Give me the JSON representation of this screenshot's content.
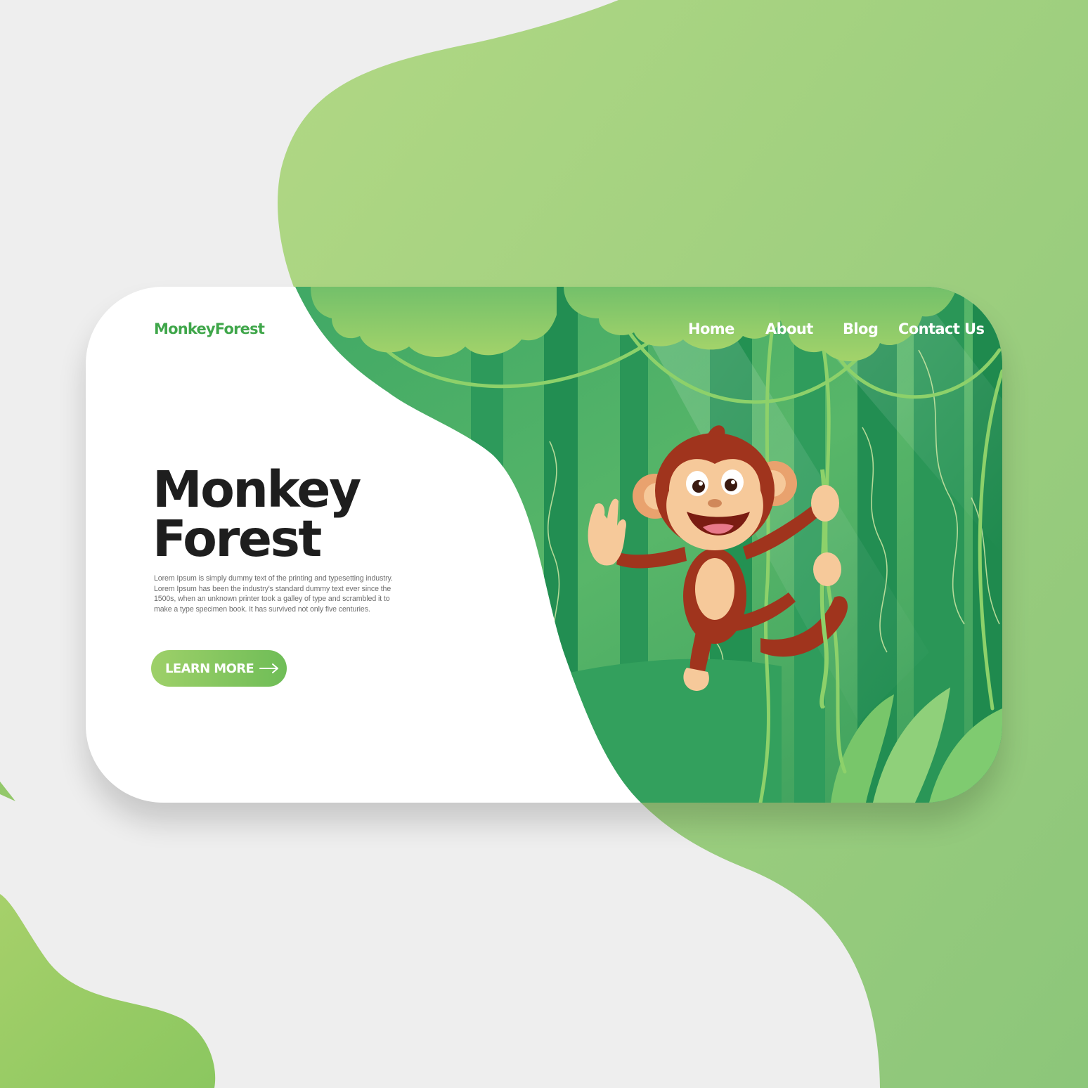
{
  "brand": {
    "logo": "MonkeyForest"
  },
  "nav": {
    "items": [
      {
        "label": "Home"
      },
      {
        "label": "About"
      },
      {
        "label": "Blog"
      },
      {
        "label": "Contact Us"
      }
    ]
  },
  "hero": {
    "title_line1": "Monkey",
    "title_line2": "Forest",
    "body": "Lorem Ipsum is simply dummy text of the printing and typesetting industry. Lorem Ipsum has been the industry's standard dummy text ever since the 1500s, when an unknown printer took a galley of type and scrambled it to make a type specimen book. It has survived not only five centuries.",
    "cta_label": "LEARN MORE"
  },
  "illustration": {
    "subject": "cartoon monkey swinging on a jungle vine"
  },
  "icons": {
    "cta_arrow": "arrow-right-icon"
  },
  "colors": {
    "accent_green": "#3fa64a",
    "light_green": "#a6d27a",
    "forest_dark": "#1f8f55",
    "monkey_brown": "#a0341d",
    "monkey_skin": "#f6c99a",
    "background": "#eeeeee"
  }
}
